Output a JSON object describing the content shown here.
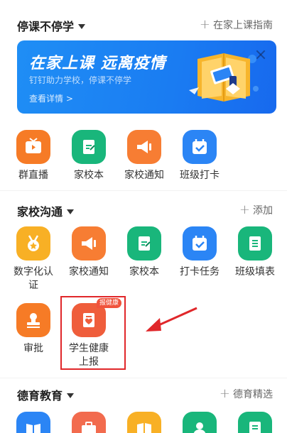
{
  "section1": {
    "title": "停课不停学",
    "action": "在家上课指南"
  },
  "banner": {
    "title": "在家上课 远离疫情",
    "subtitle": "钉钉助力学校，停课不停学",
    "link": "查看详情 >"
  },
  "row1": [
    {
      "label": "群直播",
      "icon": "tv-icon",
      "color": "#f67b26"
    },
    {
      "label": "家校本",
      "icon": "notebook-icon",
      "color": "#19b67b"
    },
    {
      "label": "家校通知",
      "icon": "megaphone-icon",
      "color": "#f77d33"
    },
    {
      "label": "班级打卡",
      "icon": "calendar-check-icon",
      "color": "#2b85f5"
    }
  ],
  "section2": {
    "title": "家校沟通",
    "action": "添加"
  },
  "row2": [
    {
      "label": "数字化认证",
      "icon": "medal-icon",
      "color": "#f8b025"
    },
    {
      "label": "家校通知",
      "icon": "megaphone-icon",
      "color": "#f77d33"
    },
    {
      "label": "家校本",
      "icon": "notebook-icon",
      "color": "#19b67b"
    },
    {
      "label": "打卡任务",
      "icon": "calendar-check-icon",
      "color": "#2b85f5"
    },
    {
      "label": "班级填表",
      "icon": "form-icon",
      "color": "#19b67b"
    }
  ],
  "row3": [
    {
      "label": "审批",
      "icon": "stamp-icon",
      "color": "#f67b26"
    },
    {
      "label": "学生健康上报",
      "icon": "health-report-icon",
      "color": "#ef5d3b",
      "badge": "报健康"
    }
  ],
  "section3": {
    "title": "德育教育",
    "action": "德育精选"
  }
}
